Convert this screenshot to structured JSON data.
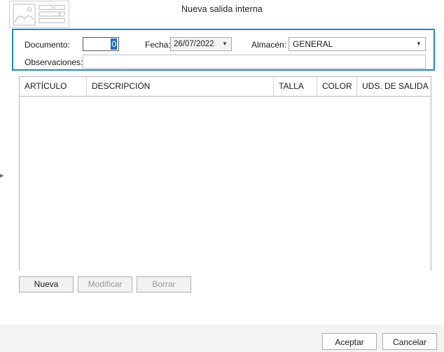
{
  "window": {
    "title": "Nueva salida interna",
    "app_icon": "image-form-icon",
    "accent_color": "#1a8ad4",
    "selection_color": "#1a6fc4"
  },
  "edge": {
    "expand_icon": "chevron-right-icon"
  },
  "form": {
    "documento": {
      "label": "Documento:",
      "value": "0",
      "selected": true
    },
    "fecha": {
      "label": "Fecha:",
      "value": "26/07/2022",
      "dropdown_icon": "chevron-down-icon"
    },
    "almacen": {
      "label": "Almacén:",
      "value": "GENERAL",
      "dropdown_icon": "chevron-down-icon"
    },
    "observaciones": {
      "label": "Observaciones:",
      "value": "",
      "placeholder": ""
    }
  },
  "grid": {
    "columns": [
      {
        "label": "ARTÍCULO"
      },
      {
        "label": "DESCRIPCIÓN"
      },
      {
        "label": "TALLA"
      },
      {
        "label": "COLOR"
      },
      {
        "label": "UDS. DE SALIDA"
      }
    ],
    "rows": []
  },
  "grid_actions": {
    "nueva": {
      "label": "Nueva",
      "enabled": true
    },
    "modificar": {
      "label": "Modificar",
      "enabled": false
    },
    "borrar": {
      "label": "Borrar",
      "enabled": false
    }
  },
  "footer": {
    "aceptar": "Aceptar",
    "cancelar": "Cancelar"
  }
}
